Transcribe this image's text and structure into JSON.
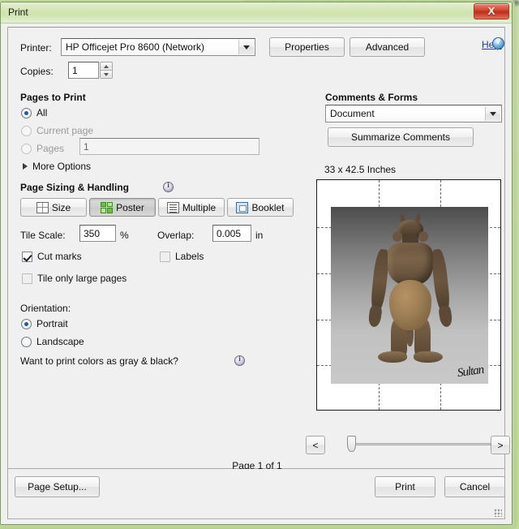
{
  "window": {
    "title": "Print",
    "close_label": "X"
  },
  "printer": {
    "label": "Printer:",
    "selected": "HP Officejet Pro 8600 (Network)",
    "properties_label": "Properties",
    "advanced_label": "Advanced"
  },
  "copies": {
    "label": "Copies:",
    "value": "1"
  },
  "help": {
    "link_label": "Help",
    "icon": "help-question-icon"
  },
  "pages_to_print": {
    "heading": "Pages to Print",
    "options": [
      {
        "label": "All",
        "selected": true,
        "enabled": true
      },
      {
        "label": "Current page",
        "selected": false,
        "enabled": false
      },
      {
        "label": "Pages",
        "selected": false,
        "enabled": false
      }
    ],
    "pages_value": "1",
    "more_options_label": "More Options"
  },
  "page_sizing": {
    "heading": "Page Sizing & Handling",
    "info_icon": "info-icon",
    "buttons": [
      {
        "label": "Size",
        "icon": "size-icon",
        "active": false
      },
      {
        "label": "Poster",
        "icon": "poster-grid-icon",
        "active": true
      },
      {
        "label": "Multiple",
        "icon": "multiple-pages-icon",
        "active": false
      },
      {
        "label": "Booklet",
        "icon": "booklet-icon",
        "active": false
      }
    ],
    "tile_scale_label": "Tile Scale:",
    "tile_scale_value": "350",
    "tile_scale_unit": "%",
    "overlap_label": "Overlap:",
    "overlap_value": "0.005",
    "overlap_unit": "in",
    "checkboxes": [
      {
        "label": "Cut marks",
        "checked": true
      },
      {
        "label": "Labels",
        "checked": false
      },
      {
        "label": "Tile only large pages",
        "checked": false
      }
    ]
  },
  "orientation": {
    "heading": "Orientation:",
    "options": [
      {
        "label": "Portrait",
        "selected": true
      },
      {
        "label": "Landscape",
        "selected": false
      }
    ],
    "gray_question": "Want to print colors as gray & black?",
    "gray_info_icon": "info-icon"
  },
  "comments_forms": {
    "heading": "Comments & Forms",
    "selected": "Document",
    "summarize_label": "Summarize Comments"
  },
  "preview": {
    "size_label": "33 x 42.5 Inches",
    "page_indicator": "Page 1 of 1",
    "prev_label": "<",
    "next_label": ">",
    "artwork_signature": "Sultan",
    "artwork_alt": "3d-creature-render"
  },
  "footer": {
    "page_setup_label": "Page Setup...",
    "print_label": "Print",
    "cancel_label": "Cancel"
  },
  "colors": {
    "title_bar": "#d4e6b4",
    "close_button": "#bc2f1c",
    "link": "#1b3fa8",
    "radio_dot": "#1d5c9e",
    "poster_icon": "#6fbf3f"
  }
}
